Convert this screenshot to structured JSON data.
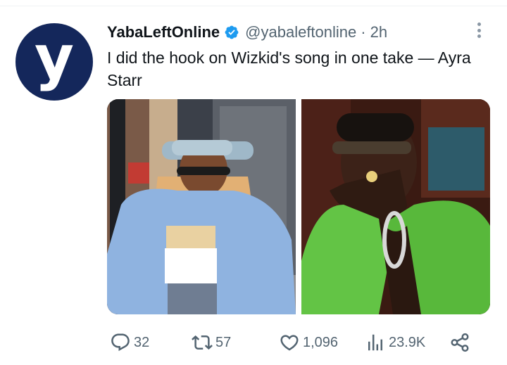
{
  "tweet": {
    "display_name": "YabaLeftOnline",
    "handle": "@yabaleftonline",
    "separator": "·",
    "time": "2h",
    "avatar_letter": "y",
    "text": "I did the hook on Wizkid's song in one take — Ayra Starr"
  },
  "media": [
    {
      "name": "ayra-starr-photo",
      "icon": "photo"
    },
    {
      "name": "wizkid-photo",
      "icon": "photo"
    }
  ],
  "actions": {
    "replies": "32",
    "retweets": "57",
    "likes": "1,096",
    "views": "23.9K"
  },
  "colors": {
    "avatar_bg": "#14275b",
    "verified": "#1d9bf0",
    "secondary_text": "#536471",
    "divider": "#eff3f4"
  },
  "icons": {
    "reply": "speech-bubble-icon",
    "retweet": "retweet-icon",
    "like": "heart-icon",
    "views": "bar-chart-icon",
    "share": "share-icon",
    "more": "more-vertical-icon",
    "verified": "verified-badge-icon"
  }
}
